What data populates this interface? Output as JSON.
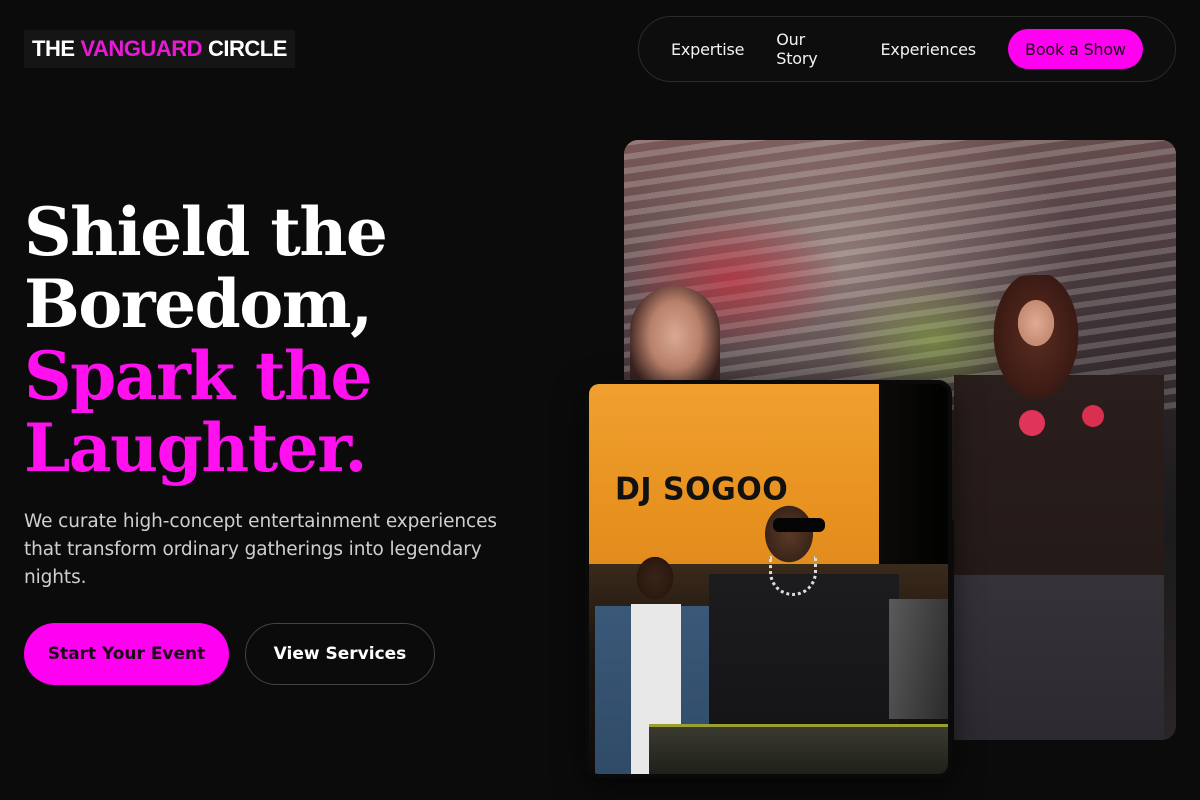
{
  "logo": {
    "part1": "THE",
    "part2": "VANGUARD",
    "part3": "CIRCLE"
  },
  "nav": {
    "items": [
      "Expertise",
      "Our Story",
      "Experiences"
    ],
    "cta": "Book a Show"
  },
  "hero": {
    "headline_white": [
      "Shield the",
      "Boredom,"
    ],
    "headline_pink": [
      "Spark the",
      "Laughter."
    ],
    "lede": "We curate high-concept entertainment experiences that transform ordinary gatherings into legendary nights.",
    "primary_button": "Start Your Event",
    "secondary_button": "View Services"
  },
  "images": {
    "front_screen_text": "DJ SOGOO"
  },
  "colors": {
    "accent": "#ff00f0",
    "background": "#0b0b0c"
  }
}
